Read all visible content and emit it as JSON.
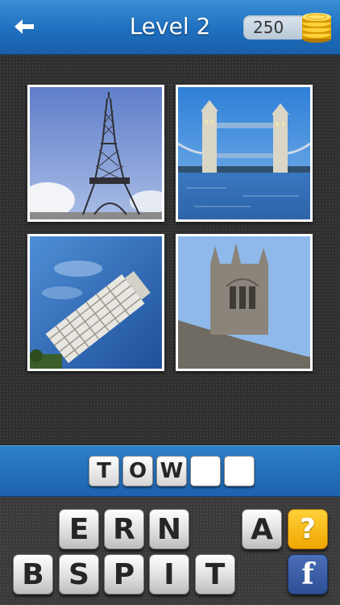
{
  "header": {
    "title": "Level 2",
    "coins": "250",
    "back_icon": "back-arrow-icon",
    "coin_icon": "coin-stack-icon"
  },
  "puzzle": {
    "images": [
      {
        "subject": "eiffel-tower-photo"
      },
      {
        "subject": "tower-bridge-photo"
      },
      {
        "subject": "leaning-tower-of-pisa-photo"
      },
      {
        "subject": "gothic-church-tower-photo"
      }
    ]
  },
  "answer": {
    "slots": [
      "T",
      "O",
      "W",
      "",
      ""
    ]
  },
  "keyboard": {
    "row1": [
      "E",
      "R",
      "N",
      "A"
    ],
    "row2": [
      "B",
      "S",
      "P",
      "I",
      "T"
    ],
    "hint_label": "?",
    "facebook_label": "f"
  },
  "colors": {
    "accent_blue": "#1f6fbf",
    "hint_gold": "#f0a500",
    "facebook_blue": "#3b5998"
  }
}
